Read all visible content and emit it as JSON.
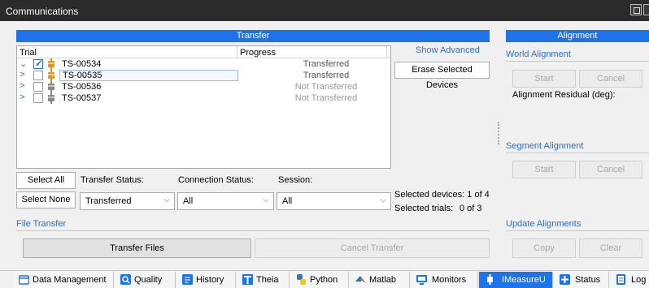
{
  "window": {
    "title": "Communications"
  },
  "transfer": {
    "header": "Transfer",
    "show_advanced": "Show Advanced",
    "columns": {
      "trial": "Trial",
      "progress": "Progress"
    },
    "rows": [
      {
        "name": "TS-00534",
        "status": "Transferred",
        "checked": true,
        "expanded": true,
        "selected": false
      },
      {
        "name": "TS-00535",
        "status": "Transferred",
        "checked": false,
        "expanded": false,
        "selected": true
      },
      {
        "name": "TS-00536",
        "status": "Not Transferred",
        "checked": false,
        "expanded": false,
        "selected": false
      },
      {
        "name": "TS-00537",
        "status": "Not Transferred",
        "checked": false,
        "expanded": false,
        "selected": false
      }
    ],
    "erase_button": "Erase Selected Devices",
    "select_all": "Select All",
    "select_none": "Select None",
    "transfer_status_label": "Transfer Status:",
    "connection_status_label": "Connection Status:",
    "session_label": "Session:",
    "transfer_status_value": "Transferred",
    "connection_status_value": "All",
    "session_value": "All",
    "selected_devices": "Selected devices: 1 of 4",
    "selected_trials_label": "Selected trials:",
    "selected_trials_value": "0 of 3",
    "file_transfer_label": "File Transfer",
    "transfer_files": "Transfer Files",
    "cancel_transfer": "Cancel Transfer"
  },
  "alignment": {
    "header": "Alignment",
    "world_alignment": "World Alignment",
    "start": "Start",
    "cancel": "Cancel",
    "residual_label": "Alignment Residual (deg):",
    "segment_alignment": "Segment Alignment",
    "segment_start": "Start",
    "segment_cancel": "Cancel",
    "update_alignments": "Update Alignments",
    "copy": "Copy",
    "clear": "Clear"
  },
  "tabs": [
    {
      "label": "Data Management",
      "icon": "folder-icon"
    },
    {
      "label": "Quality",
      "icon": "magnifier-icon"
    },
    {
      "label": "History",
      "icon": "history-icon"
    },
    {
      "label": "Theia",
      "icon": "theia-icon"
    },
    {
      "label": "Python",
      "icon": "python-icon"
    },
    {
      "label": "Matlab",
      "icon": "matlab-icon"
    },
    {
      "label": "Monitors",
      "icon": "monitor-icon"
    },
    {
      "label": "IMeasureU",
      "icon": "sensor-icon",
      "active": true
    },
    {
      "label": "Status",
      "icon": "plus-icon"
    },
    {
      "label": "Log",
      "icon": "document-icon"
    }
  ],
  "colors": {
    "accent": "#1e73e8",
    "link": "#2a6edb",
    "device": "#e8951e"
  }
}
